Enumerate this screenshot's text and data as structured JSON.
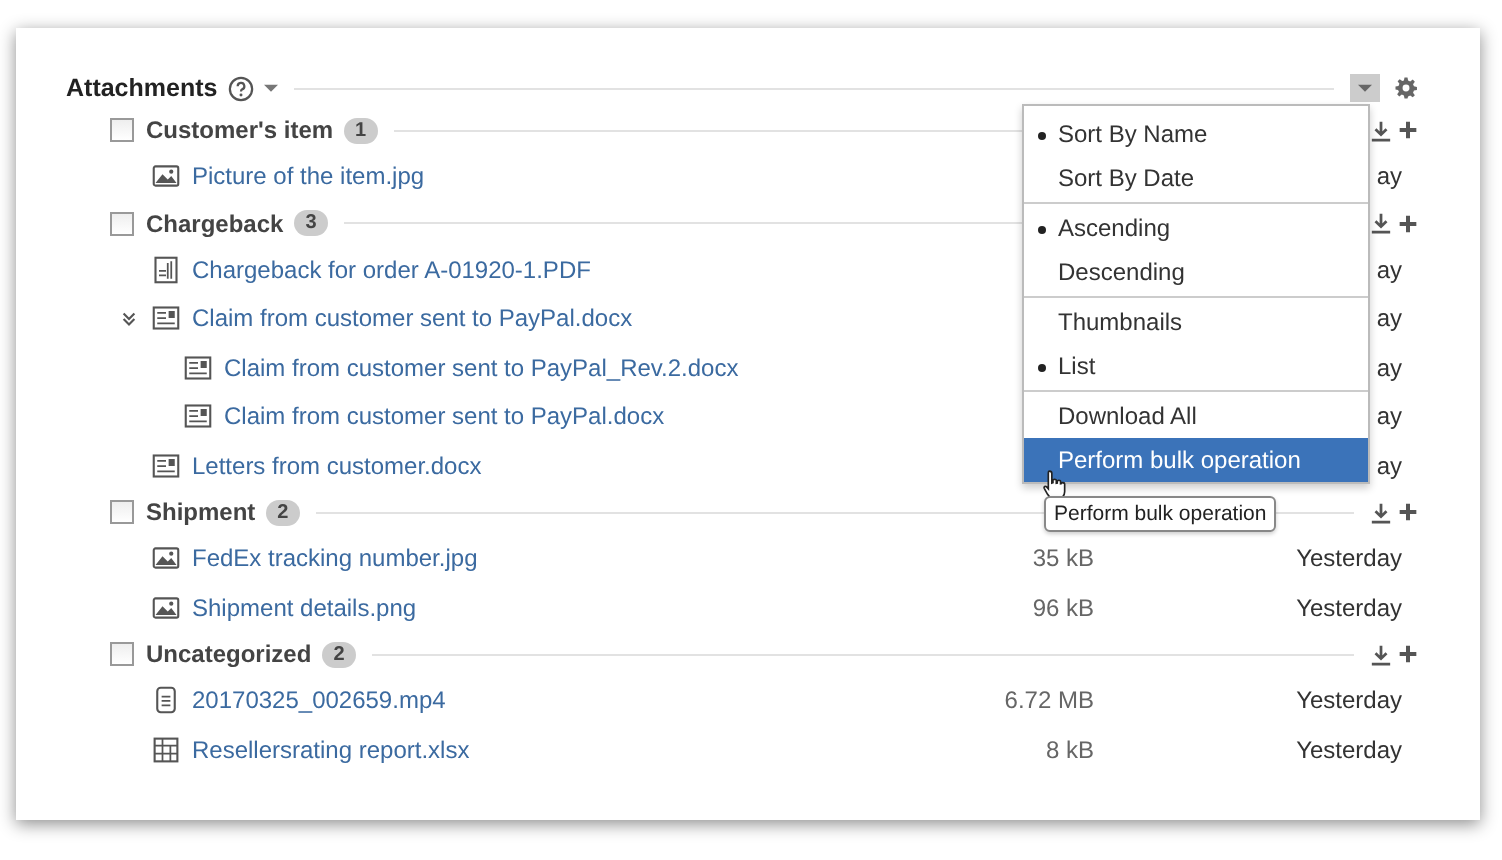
{
  "header": {
    "title": "Attachments"
  },
  "groups": [
    {
      "name": "Customer's item",
      "count": "1",
      "checked": false,
      "files": [
        {
          "kind": "image",
          "name": "Picture of the item.jpg",
          "date": "ay"
        }
      ]
    },
    {
      "name": "Chargeback",
      "count": "3",
      "checked": false,
      "files": [
        {
          "kind": "pdf",
          "name": "Chargeback for order A-01920-1.PDF",
          "date": "ay"
        },
        {
          "kind": "doc",
          "name": "Claim from customer sent to PayPal.docx",
          "date": "ay",
          "expanded": true,
          "children": [
            {
              "kind": "doc",
              "name": "Claim from customer sent to PayPal_Rev.2.docx",
              "date": "ay"
            },
            {
              "kind": "doc",
              "name": "Claim from customer sent to PayPal.docx",
              "date": "ay"
            }
          ]
        },
        {
          "kind": "doc",
          "name": "Letters from customer.docx",
          "date": "ay"
        }
      ]
    },
    {
      "name": "Shipment",
      "count": "2",
      "checked": false,
      "files": [
        {
          "kind": "image",
          "name": "FedEx tracking number.jpg",
          "size": "35 kB",
          "date": "Yesterday"
        },
        {
          "kind": "image",
          "name": "Shipment details.png",
          "size": "96 kB",
          "date": "Yesterday"
        }
      ]
    },
    {
      "name": "Uncategorized",
      "count": "2",
      "checked": false,
      "files": [
        {
          "kind": "video",
          "name": "20170325_002659.mp4",
          "size": "6.72 MB",
          "date": "Yesterday"
        },
        {
          "kind": "sheet",
          "name": "Resellersrating report.xlsx",
          "size": "8 kB",
          "date": "Yesterday"
        }
      ]
    }
  ],
  "menu": {
    "sections": [
      [
        {
          "label": "Sort By Name",
          "selected": true,
          "hovered": false
        },
        {
          "label": "Sort By Date",
          "selected": false,
          "hovered": false
        }
      ],
      [
        {
          "label": "Ascending",
          "selected": true,
          "hovered": false
        },
        {
          "label": "Descending",
          "selected": false,
          "hovered": false
        }
      ],
      [
        {
          "label": "Thumbnails",
          "selected": false,
          "hovered": false
        },
        {
          "label": "List",
          "selected": true,
          "hovered": false
        }
      ],
      [
        {
          "label": "Download All",
          "selected": false,
          "hovered": false
        },
        {
          "label": "Perform bulk operation",
          "selected": false,
          "hovered": true
        }
      ]
    ],
    "tooltip": "Perform bulk operation"
  }
}
